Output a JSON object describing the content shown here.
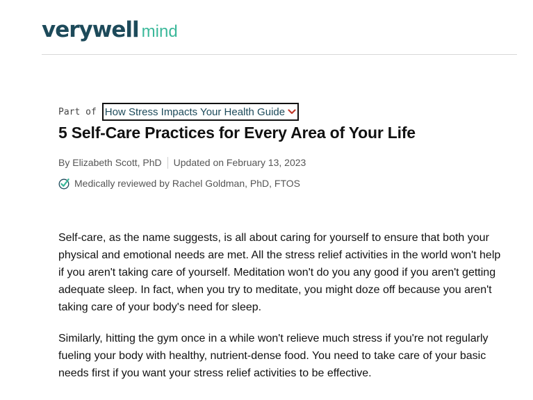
{
  "header": {
    "logo_main": "verywell",
    "logo_sub": "mind"
  },
  "guide": {
    "prefix": "Part of",
    "name": "How Stress Impacts Your Health Guide"
  },
  "article": {
    "title": "5 Self-Care Practices for Every Area of Your Life",
    "byline_author": "By Elizabeth Scott, PhD",
    "byline_updated": "Updated on February 13, 2023",
    "reviewed": "Medically reviewed by Rachel Goldman, PhD, FTOS",
    "paragraphs": [
      "Self-care, as the name suggests, is all about caring for yourself to ensure that both your physical and emotional needs are met. All the stress relief activities in the world won't help if you aren't taking care of yourself. Meditation won't do you any good if you aren't getting adequate sleep. In fact, when you try to meditate, you might doze off because you aren't taking care of your body's need for sleep.",
      "Similarly, hitting the gym once in a while won't relieve much stress if you're not regularly fueling your body with healthy, nutrient-dense food. You need to take care of your basic needs first if you want your stress relief activities to be effective."
    ]
  },
  "icons": {
    "guide_dropdown": "chevron-down-icon",
    "reviewed": "check-badge-icon"
  },
  "colors": {
    "brand_dark": "#1d4a5a",
    "brand_accent": "#3bb89a",
    "chevron": "#c0392b"
  }
}
